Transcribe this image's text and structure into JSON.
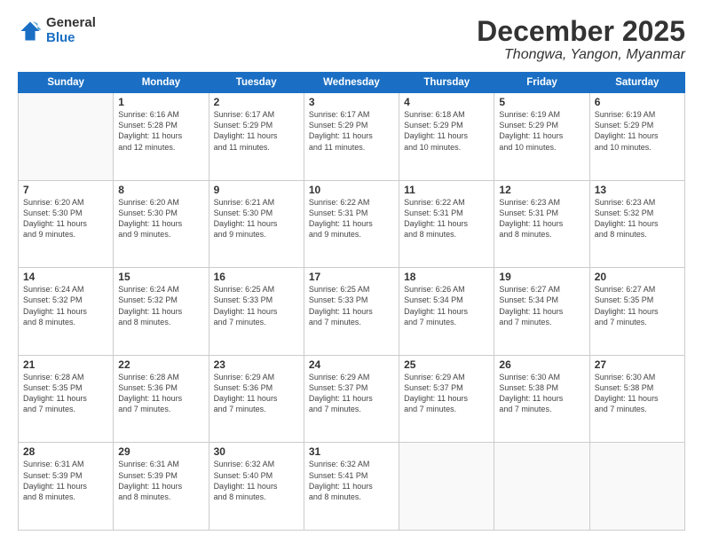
{
  "logo": {
    "general": "General",
    "blue": "Blue"
  },
  "header": {
    "month": "December 2025",
    "location": "Thongwa, Yangon, Myanmar"
  },
  "days_of_week": [
    "Sunday",
    "Monday",
    "Tuesday",
    "Wednesday",
    "Thursday",
    "Friday",
    "Saturday"
  ],
  "weeks": [
    [
      {
        "day": "",
        "info": ""
      },
      {
        "day": "1",
        "info": "Sunrise: 6:16 AM\nSunset: 5:28 PM\nDaylight: 11 hours\nand 12 minutes."
      },
      {
        "day": "2",
        "info": "Sunrise: 6:17 AM\nSunset: 5:29 PM\nDaylight: 11 hours\nand 11 minutes."
      },
      {
        "day": "3",
        "info": "Sunrise: 6:17 AM\nSunset: 5:29 PM\nDaylight: 11 hours\nand 11 minutes."
      },
      {
        "day": "4",
        "info": "Sunrise: 6:18 AM\nSunset: 5:29 PM\nDaylight: 11 hours\nand 10 minutes."
      },
      {
        "day": "5",
        "info": "Sunrise: 6:19 AM\nSunset: 5:29 PM\nDaylight: 11 hours\nand 10 minutes."
      },
      {
        "day": "6",
        "info": "Sunrise: 6:19 AM\nSunset: 5:29 PM\nDaylight: 11 hours\nand 10 minutes."
      }
    ],
    [
      {
        "day": "7",
        "info": "Sunrise: 6:20 AM\nSunset: 5:30 PM\nDaylight: 11 hours\nand 9 minutes."
      },
      {
        "day": "8",
        "info": "Sunrise: 6:20 AM\nSunset: 5:30 PM\nDaylight: 11 hours\nand 9 minutes."
      },
      {
        "day": "9",
        "info": "Sunrise: 6:21 AM\nSunset: 5:30 PM\nDaylight: 11 hours\nand 9 minutes."
      },
      {
        "day": "10",
        "info": "Sunrise: 6:22 AM\nSunset: 5:31 PM\nDaylight: 11 hours\nand 9 minutes."
      },
      {
        "day": "11",
        "info": "Sunrise: 6:22 AM\nSunset: 5:31 PM\nDaylight: 11 hours\nand 8 minutes."
      },
      {
        "day": "12",
        "info": "Sunrise: 6:23 AM\nSunset: 5:31 PM\nDaylight: 11 hours\nand 8 minutes."
      },
      {
        "day": "13",
        "info": "Sunrise: 6:23 AM\nSunset: 5:32 PM\nDaylight: 11 hours\nand 8 minutes."
      }
    ],
    [
      {
        "day": "14",
        "info": "Sunrise: 6:24 AM\nSunset: 5:32 PM\nDaylight: 11 hours\nand 8 minutes."
      },
      {
        "day": "15",
        "info": "Sunrise: 6:24 AM\nSunset: 5:32 PM\nDaylight: 11 hours\nand 8 minutes."
      },
      {
        "day": "16",
        "info": "Sunrise: 6:25 AM\nSunset: 5:33 PM\nDaylight: 11 hours\nand 7 minutes."
      },
      {
        "day": "17",
        "info": "Sunrise: 6:25 AM\nSunset: 5:33 PM\nDaylight: 11 hours\nand 7 minutes."
      },
      {
        "day": "18",
        "info": "Sunrise: 6:26 AM\nSunset: 5:34 PM\nDaylight: 11 hours\nand 7 minutes."
      },
      {
        "day": "19",
        "info": "Sunrise: 6:27 AM\nSunset: 5:34 PM\nDaylight: 11 hours\nand 7 minutes."
      },
      {
        "day": "20",
        "info": "Sunrise: 6:27 AM\nSunset: 5:35 PM\nDaylight: 11 hours\nand 7 minutes."
      }
    ],
    [
      {
        "day": "21",
        "info": "Sunrise: 6:28 AM\nSunset: 5:35 PM\nDaylight: 11 hours\nand 7 minutes."
      },
      {
        "day": "22",
        "info": "Sunrise: 6:28 AM\nSunset: 5:36 PM\nDaylight: 11 hours\nand 7 minutes."
      },
      {
        "day": "23",
        "info": "Sunrise: 6:29 AM\nSunset: 5:36 PM\nDaylight: 11 hours\nand 7 minutes."
      },
      {
        "day": "24",
        "info": "Sunrise: 6:29 AM\nSunset: 5:37 PM\nDaylight: 11 hours\nand 7 minutes."
      },
      {
        "day": "25",
        "info": "Sunrise: 6:29 AM\nSunset: 5:37 PM\nDaylight: 11 hours\nand 7 minutes."
      },
      {
        "day": "26",
        "info": "Sunrise: 6:30 AM\nSunset: 5:38 PM\nDaylight: 11 hours\nand 7 minutes."
      },
      {
        "day": "27",
        "info": "Sunrise: 6:30 AM\nSunset: 5:38 PM\nDaylight: 11 hours\nand 7 minutes."
      }
    ],
    [
      {
        "day": "28",
        "info": "Sunrise: 6:31 AM\nSunset: 5:39 PM\nDaylight: 11 hours\nand 8 minutes."
      },
      {
        "day": "29",
        "info": "Sunrise: 6:31 AM\nSunset: 5:39 PM\nDaylight: 11 hours\nand 8 minutes."
      },
      {
        "day": "30",
        "info": "Sunrise: 6:32 AM\nSunset: 5:40 PM\nDaylight: 11 hours\nand 8 minutes."
      },
      {
        "day": "31",
        "info": "Sunrise: 6:32 AM\nSunset: 5:41 PM\nDaylight: 11 hours\nand 8 minutes."
      },
      {
        "day": "",
        "info": ""
      },
      {
        "day": "",
        "info": ""
      },
      {
        "day": "",
        "info": ""
      }
    ]
  ]
}
